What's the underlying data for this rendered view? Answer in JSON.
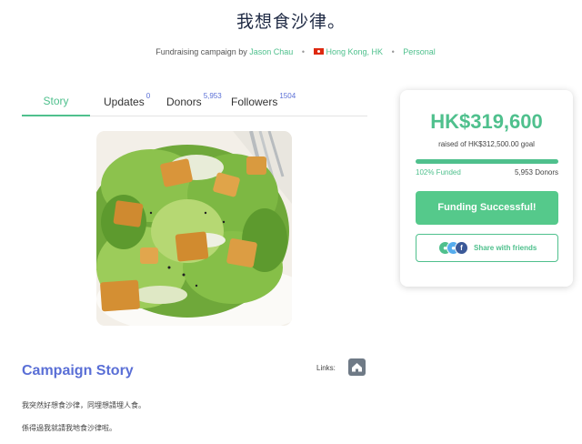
{
  "page": {
    "title": "我想食沙律。"
  },
  "byline": {
    "prefix": "Fundraising campaign by",
    "author": "Jason Chau",
    "location": "Hong Kong, HK",
    "category": "Personal"
  },
  "tabs": [
    {
      "label": "Story",
      "count": ""
    },
    {
      "label": "Updates",
      "count": "0"
    },
    {
      "label": "Donors",
      "count": "5,953"
    },
    {
      "label": "Followers",
      "count": "1504"
    }
  ],
  "image": {
    "icon": "salad-photo"
  },
  "card": {
    "amount": "HK$319,600",
    "goal_text": "raised of HK$312,500.00 goal",
    "funded_text": "102% Funded",
    "funded_percent": 100,
    "donors_text": "5,953 Donors",
    "funded_button": "Funding Successful!",
    "share_button": "Share with friends"
  },
  "story": {
    "heading": "Campaign Story",
    "links_label": "Links:",
    "paragraphs": [
      "我突然好想食沙律，同埋想請埋人食。",
      "係得過我就請我地食沙律啦。"
    ]
  },
  "colors": {
    "accent": "#4fc08d",
    "heading": "#5a6fd6",
    "title": "#1f2a44"
  }
}
